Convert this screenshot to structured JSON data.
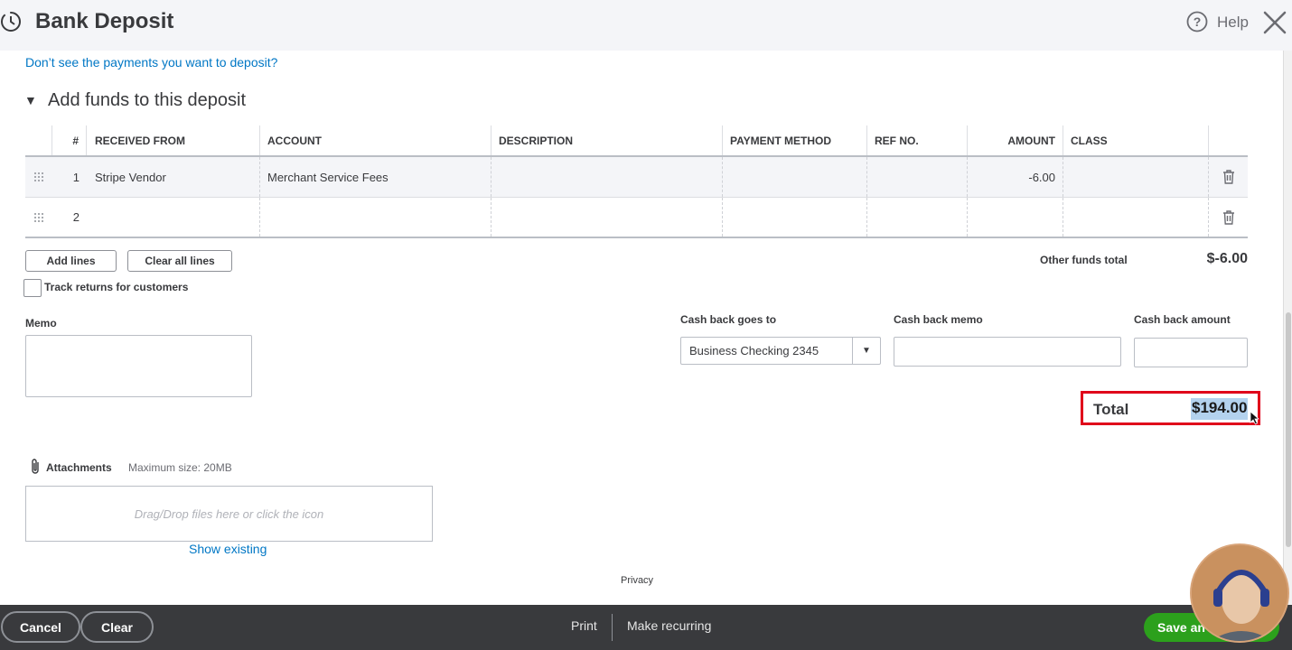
{
  "header": {
    "title": "Bank Deposit",
    "help_label": "Help"
  },
  "payments_link": "Don’t see the payments you want to deposit?",
  "section": {
    "toggle": "▼",
    "title": "Add funds to this deposit"
  },
  "table": {
    "columns": [
      "#",
      "RECEIVED FROM",
      "ACCOUNT",
      "DESCRIPTION",
      "PAYMENT METHOD",
      "REF NO.",
      "AMOUNT",
      "CLASS"
    ],
    "rows": [
      {
        "num": "1",
        "received_from": "Stripe Vendor",
        "account": "Merchant Service Fees",
        "description": "",
        "payment_method": "",
        "ref_no": "",
        "amount": "-6.00",
        "class": ""
      },
      {
        "num": "2",
        "received_from": "",
        "account": "",
        "description": "",
        "payment_method": "",
        "ref_no": "",
        "amount": "",
        "class": ""
      }
    ]
  },
  "actions": {
    "add_lines": "Add lines",
    "clear_all_lines": "Clear all lines"
  },
  "other_funds": {
    "label": "Other funds total",
    "value": "$-6.00"
  },
  "track_returns": {
    "label": "Track returns for customers",
    "checked": false
  },
  "memo": {
    "label": "Memo",
    "value": ""
  },
  "cash_back": {
    "goes_to_label": "Cash back goes to",
    "goes_to_value": "Business Checking 2345",
    "memo_label": "Cash back memo",
    "memo_value": "",
    "amount_label": "Cash back amount",
    "amount_value": ""
  },
  "total": {
    "label": "Total",
    "value": "$194.00"
  },
  "attachments": {
    "label": "Attachments",
    "max_size": "Maximum size: 20MB",
    "dropzone": "Drag/Drop files here or click the icon",
    "show_existing": "Show existing"
  },
  "privacy": "Privacy",
  "footer": {
    "cancel": "Cancel",
    "clear": "Clear",
    "print": "Print",
    "make_recurring": "Make recurring",
    "save": "Save an"
  },
  "colors": {
    "link": "#0077c5",
    "highlight_border": "#e0001a",
    "save_green": "#2ca01c",
    "footer_bg": "#393a3d"
  }
}
